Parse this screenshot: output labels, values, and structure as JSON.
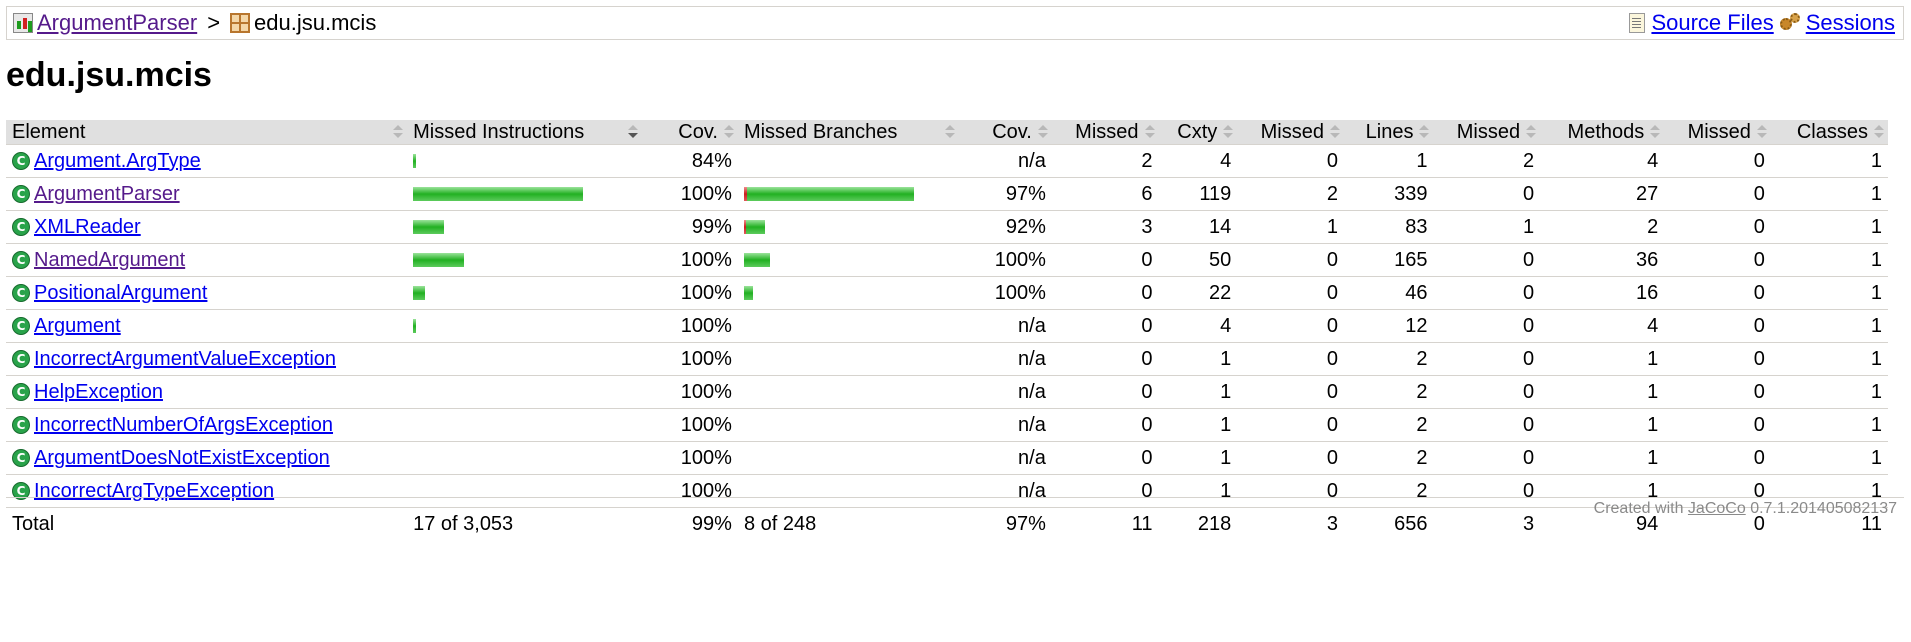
{
  "breadcrumb": {
    "report_label": "ArgumentParser",
    "separator": ">",
    "package_label": "edu.jsu.mcis",
    "source_files_label": "Source Files",
    "sessions_label": "Sessions"
  },
  "page_title": "edu.jsu.mcis",
  "table": {
    "headers": {
      "element": "Element",
      "missed_instructions": "Missed Instructions",
      "cov_instructions": "Cov.",
      "missed_branches": "Missed Branches",
      "cov_branches": "Cov.",
      "missed_cxty": "Missed",
      "cxty": "Cxty",
      "missed_lines": "Missed",
      "lines": "Lines",
      "missed_methods": "Missed",
      "methods": "Methods",
      "missed_classes": "Missed",
      "classes": "Classes"
    },
    "rows": [
      {
        "name": "Argument.ArgType",
        "visited": false,
        "instr_cov": "84%",
        "branch_cov": "n/a",
        "missed_cxty": "2",
        "cxty": "4",
        "missed_lines": "0",
        "lines": "1",
        "missed_methods": "2",
        "methods": "4",
        "missed_classes": "0",
        "classes": "1",
        "instr_bar": {
          "red": 0,
          "green": 0.02
        },
        "branch_bar": null
      },
      {
        "name": "ArgumentParser",
        "visited": true,
        "instr_cov": "100%",
        "branch_cov": "97%",
        "missed_cxty": "6",
        "cxty": "119",
        "missed_lines": "2",
        "lines": "339",
        "missed_methods": "0",
        "methods": "27",
        "missed_classes": "0",
        "classes": "1",
        "instr_bar": {
          "red": 0,
          "green": 1.0
        },
        "branch_bar": {
          "red": 0.02,
          "green": 0.98
        }
      },
      {
        "name": "XMLReader",
        "visited": false,
        "instr_cov": "99%",
        "branch_cov": "92%",
        "missed_cxty": "3",
        "cxty": "14",
        "missed_lines": "1",
        "lines": "83",
        "missed_methods": "1",
        "methods": "2",
        "missed_classes": "0",
        "classes": "1",
        "instr_bar": {
          "red": 0,
          "green": 0.18
        },
        "branch_bar": {
          "red": 0.01,
          "green": 0.11
        }
      },
      {
        "name": "NamedArgument",
        "visited": true,
        "instr_cov": "100%",
        "branch_cov": "100%",
        "missed_cxty": "0",
        "cxty": "50",
        "missed_lines": "0",
        "lines": "165",
        "missed_methods": "0",
        "methods": "36",
        "missed_classes": "0",
        "classes": "1",
        "instr_bar": {
          "red": 0,
          "green": 0.3
        },
        "branch_bar": {
          "red": 0,
          "green": 0.15
        }
      },
      {
        "name": "PositionalArgument",
        "visited": false,
        "instr_cov": "100%",
        "branch_cov": "100%",
        "missed_cxty": "0",
        "cxty": "22",
        "missed_lines": "0",
        "lines": "46",
        "missed_methods": "0",
        "methods": "16",
        "missed_classes": "0",
        "classes": "1",
        "instr_bar": {
          "red": 0,
          "green": 0.07
        },
        "branch_bar": {
          "red": 0,
          "green": 0.05
        }
      },
      {
        "name": "Argument",
        "visited": false,
        "instr_cov": "100%",
        "branch_cov": "n/a",
        "missed_cxty": "0",
        "cxty": "4",
        "missed_lines": "0",
        "lines": "12",
        "missed_methods": "0",
        "methods": "4",
        "missed_classes": "0",
        "classes": "1",
        "instr_bar": {
          "red": 0,
          "green": 0.01
        },
        "branch_bar": null
      },
      {
        "name": "IncorrectArgumentValueException",
        "visited": false,
        "instr_cov": "100%",
        "branch_cov": "n/a",
        "missed_cxty": "0",
        "cxty": "1",
        "missed_lines": "0",
        "lines": "2",
        "missed_methods": "0",
        "methods": "1",
        "missed_classes": "0",
        "classes": "1",
        "instr_bar": null,
        "branch_bar": null
      },
      {
        "name": "HelpException",
        "visited": false,
        "instr_cov": "100%",
        "branch_cov": "n/a",
        "missed_cxty": "0",
        "cxty": "1",
        "missed_lines": "0",
        "lines": "2",
        "missed_methods": "0",
        "methods": "1",
        "missed_classes": "0",
        "classes": "1",
        "instr_bar": null,
        "branch_bar": null
      },
      {
        "name": "IncorrectNumberOfArgsException",
        "visited": false,
        "instr_cov": "100%",
        "branch_cov": "n/a",
        "missed_cxty": "0",
        "cxty": "1",
        "missed_lines": "0",
        "lines": "2",
        "missed_methods": "0",
        "methods": "1",
        "missed_classes": "0",
        "classes": "1",
        "instr_bar": null,
        "branch_bar": null
      },
      {
        "name": "ArgumentDoesNotExistException",
        "visited": false,
        "instr_cov": "100%",
        "branch_cov": "n/a",
        "missed_cxty": "0",
        "cxty": "1",
        "missed_lines": "0",
        "lines": "2",
        "missed_methods": "0",
        "methods": "1",
        "missed_classes": "0",
        "classes": "1",
        "instr_bar": null,
        "branch_bar": null
      },
      {
        "name": "IncorrectArgTypeException",
        "visited": false,
        "instr_cov": "100%",
        "branch_cov": "n/a",
        "missed_cxty": "0",
        "cxty": "1",
        "missed_lines": "0",
        "lines": "2",
        "missed_methods": "0",
        "methods": "1",
        "missed_classes": "0",
        "classes": "1",
        "instr_bar": null,
        "branch_bar": null
      }
    ],
    "total": {
      "label": "Total",
      "missed_instructions": "17 of 3,053",
      "instr_cov": "99%",
      "missed_branches": "8 of 248",
      "branch_cov": "97%",
      "missed_cxty": "11",
      "cxty": "218",
      "missed_lines": "3",
      "lines": "656",
      "missed_methods": "3",
      "methods": "94",
      "missed_classes": "0",
      "classes": "11"
    }
  },
  "footer": {
    "prefix": "Created with",
    "link": "JaCoCo",
    "version": "0.7.1.201405082137"
  },
  "colors": {
    "bar_covered": "#22b022",
    "bar_missed": "#c81e1e",
    "link": "#0000ee",
    "link_visited": "#551a8b",
    "header_bg": "#e0e0e0"
  },
  "icons": {
    "report": "report-icon",
    "package": "package-icon",
    "source_files": "source-file-icon",
    "sessions": "sessions-icon",
    "class": "class-icon",
    "sort": "sort-icon"
  }
}
